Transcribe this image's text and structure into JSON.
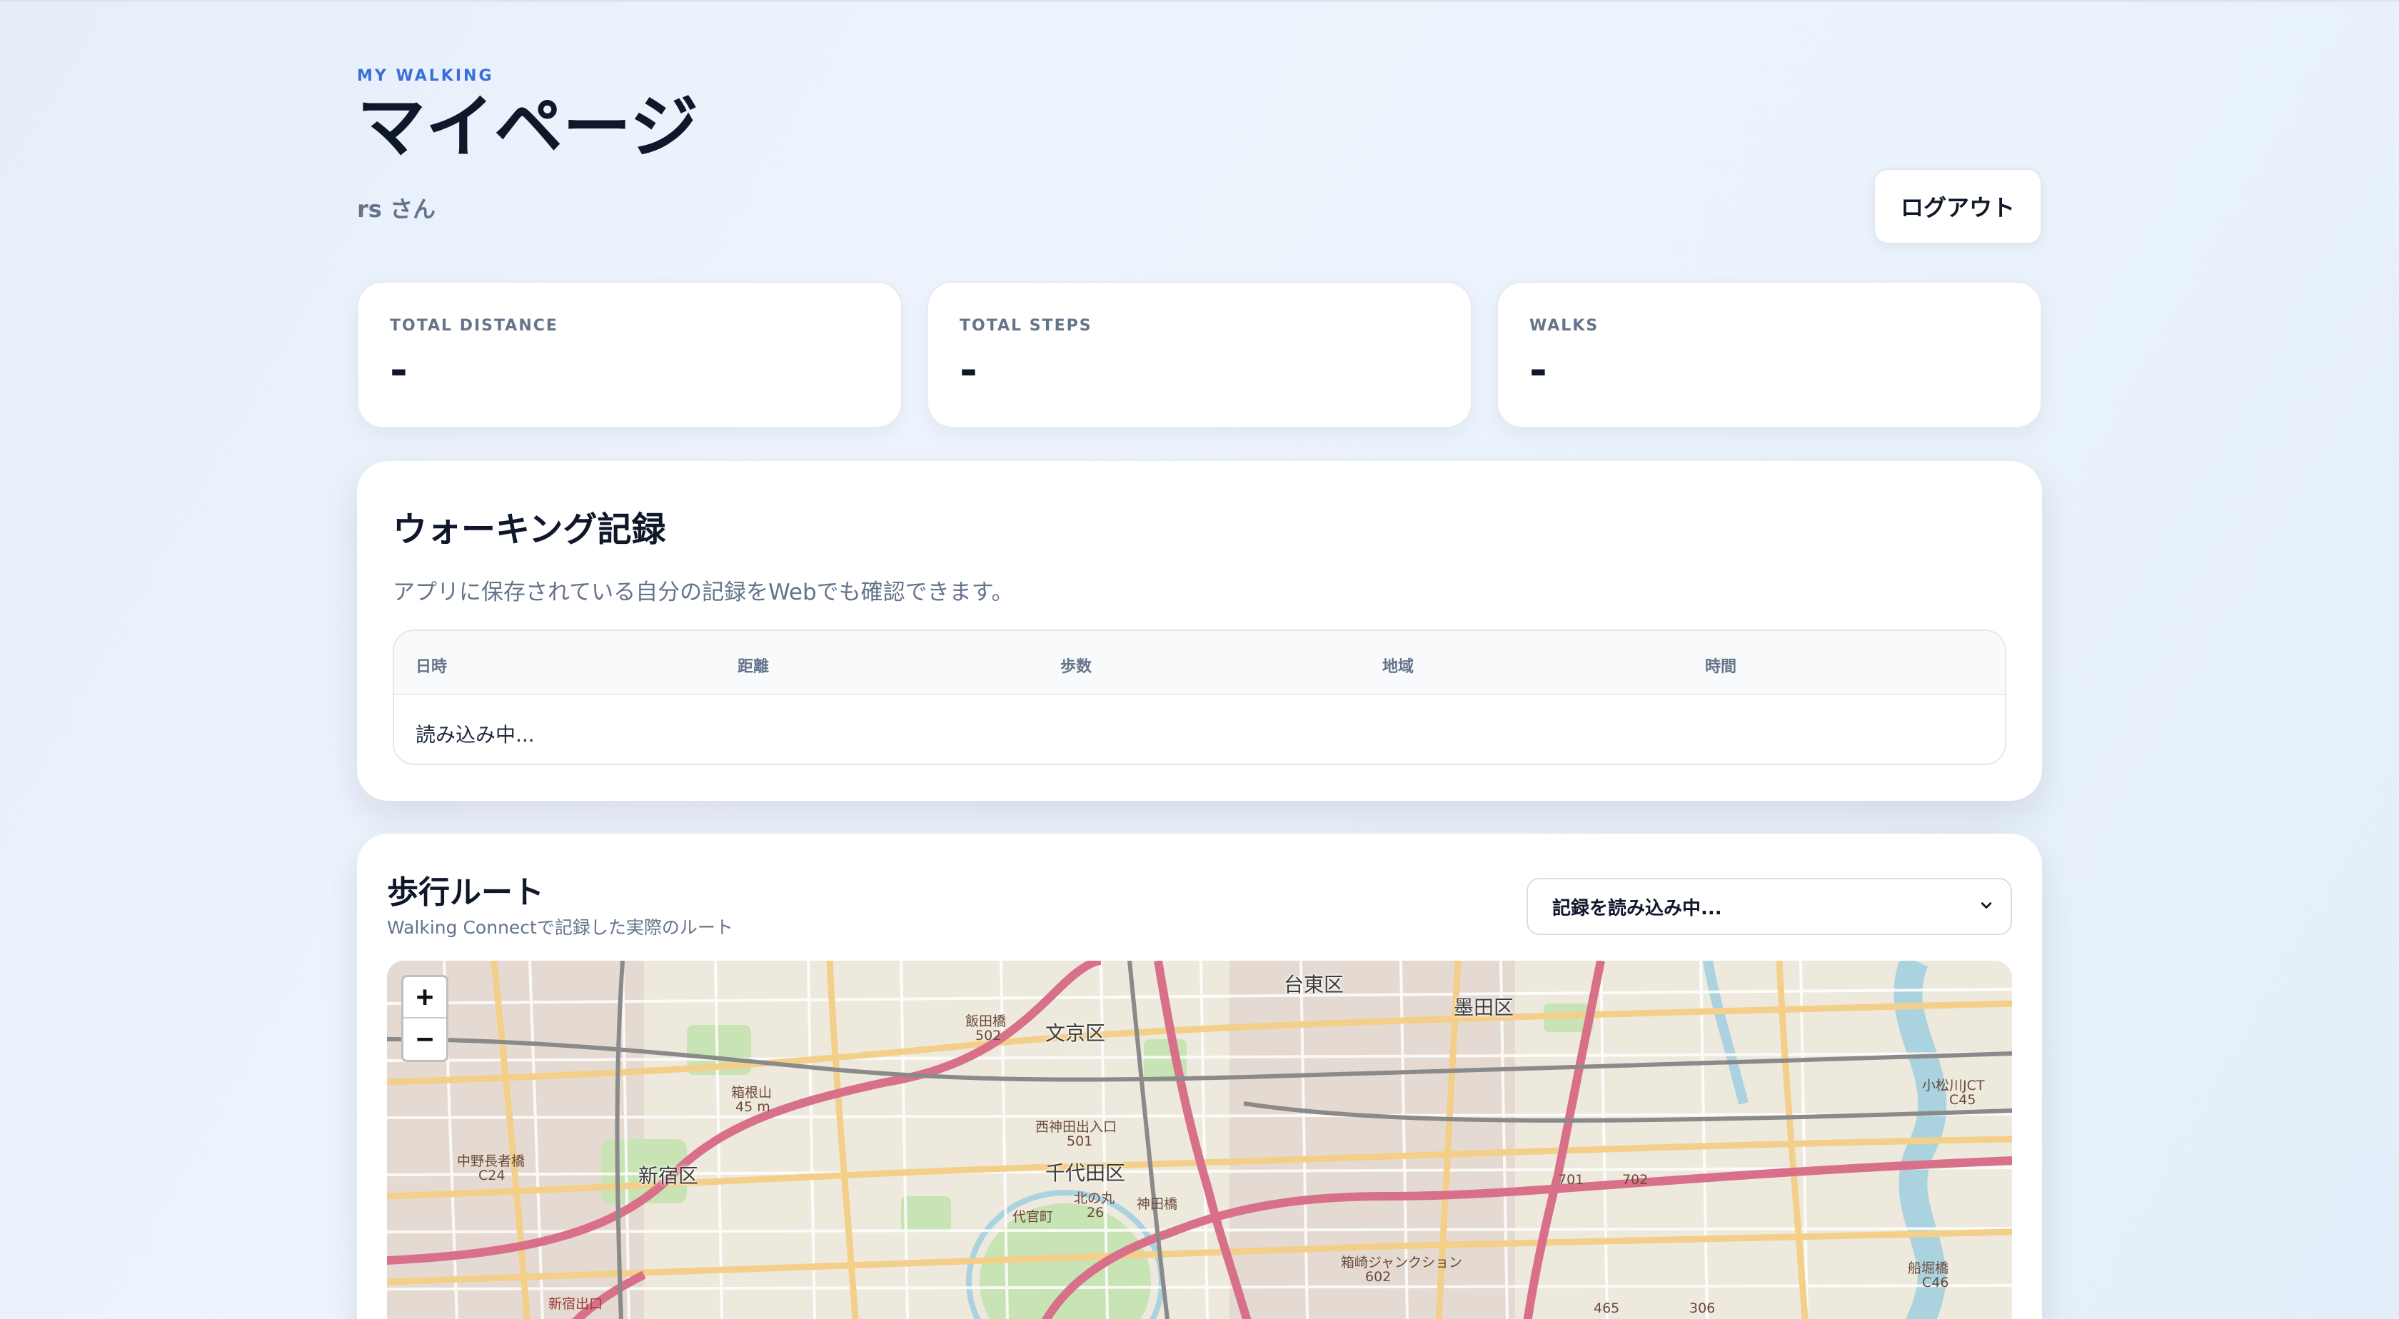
{
  "header": {
    "eyebrow": "MY WALKING",
    "title": "マイページ",
    "user": "rs さん",
    "logout_label": "ログアウト"
  },
  "stats": [
    {
      "label": "TOTAL DISTANCE",
      "value": "-"
    },
    {
      "label": "TOTAL STEPS",
      "value": "-"
    },
    {
      "label": "WALKS",
      "value": "-"
    }
  ],
  "records": {
    "title": "ウォーキング記録",
    "description": "アプリに保存されている自分の記録をWebでも確認できます。",
    "columns": [
      "日時",
      "距離",
      "歩数",
      "地域",
      "時間"
    ],
    "loading_text": "読み込み中..."
  },
  "route": {
    "title": "歩行ルート",
    "subtitle": "Walking Connectで記録した実際のルート",
    "select_value": "記録を読み込み中...",
    "zoom_in": "+",
    "zoom_out": "−"
  },
  "map": {
    "labels": {
      "taito": "台東区",
      "sumida": "墨田区",
      "bunkyo": "文京区",
      "shinjuku": "新宿区",
      "chiyoda": "千代田区",
      "iidabashi": "飯田橋",
      "iidabashi_no": "502",
      "nishikanda": "西神田出入口",
      "nishikanda_no": "501",
      "hakoneyama": "箱根山",
      "hakoneyama_alt": "45 m",
      "nakanochojabashi": "中野長者橋",
      "nakanochojabashi_no": "C24",
      "kitanomaru": "北の丸",
      "kitanomaru_no": "26",
      "jimbocho": "神田橋",
      "daikanzaka": "代官町",
      "hakozaki": "箱崎ジャンクション",
      "hakozaki_no": "602",
      "komatsugawa": "小松川JCT",
      "komatsugawa_no": "C45",
      "funabori": "船堀橋",
      "funabori_no": "C46",
      "road_465": "465",
      "road_306": "306",
      "road_701": "701",
      "road_702": "702",
      "shinjuku_exit": "新宿出口"
    }
  },
  "colors": {
    "accent": "#3b6fd8",
    "text": "#0f172a",
    "muted": "#64748b"
  }
}
